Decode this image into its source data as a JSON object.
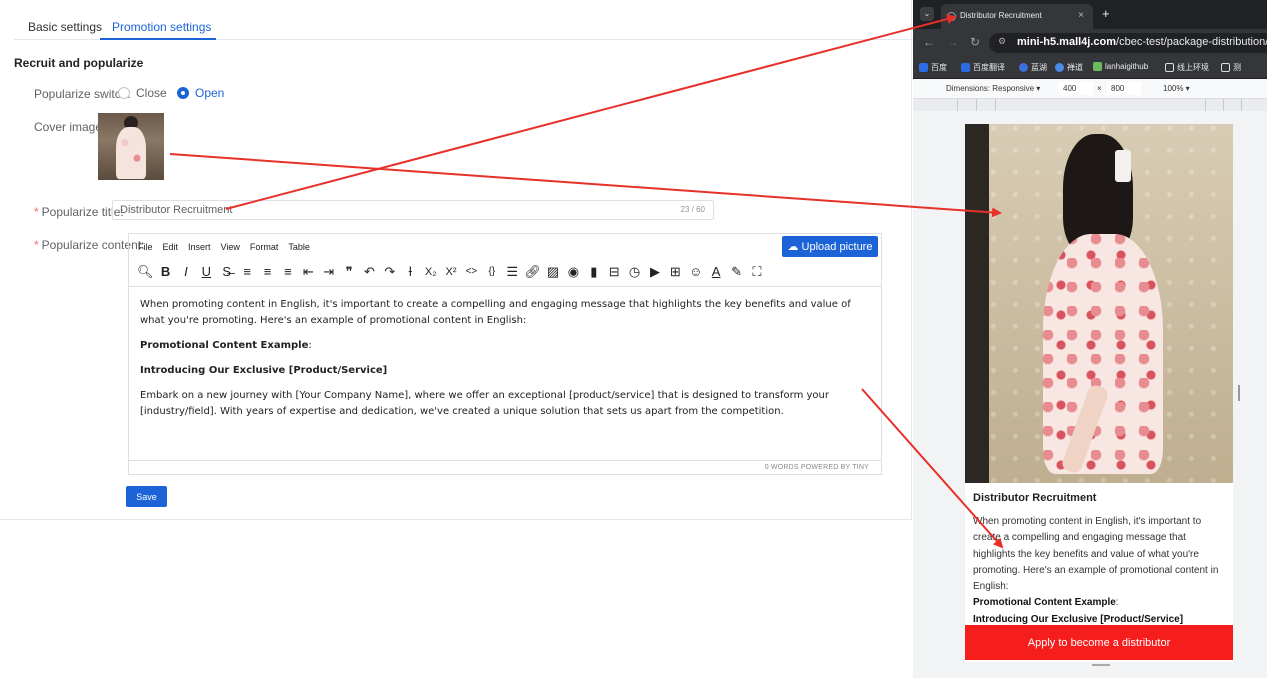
{
  "admin": {
    "tabs": [
      "Basic settings",
      "Promotion settings"
    ],
    "section_title": "Recruit and popularize",
    "switch_label": "Popularize switch:",
    "switch_options": [
      "Close",
      "Open"
    ],
    "cover_label": "Cover image:",
    "title_label": "Popularize title:",
    "title_value": "Distributor Recruitment",
    "title_count": "23 / 60",
    "content_label": "Popularize content:",
    "editor": {
      "menus": [
        "File",
        "Edit",
        "Insert",
        "View",
        "Format",
        "Table"
      ],
      "upload_button": "Upload picture",
      "toolbar_icons": [
        "search-icon",
        "bold-icon",
        "italic-icon",
        "underline-icon",
        "strikethrough-icon",
        "align-left-icon",
        "align-center-icon",
        "align-right-icon",
        "outdent-icon",
        "indent-icon",
        "blockquote-icon",
        "undo-icon",
        "redo-icon",
        "clear-format-icon",
        "subscript-icon",
        "superscript-icon",
        "code-icon",
        "code-block-icon",
        "list-icon",
        "link-icon",
        "image-icon",
        "preview-icon",
        "bookmark-icon",
        "page-break-icon",
        "time-icon",
        "media-icon",
        "table-icon",
        "emoji-icon",
        "text-color-icon",
        "highlight-icon",
        "fullscreen-icon"
      ],
      "paragraph_1": "When promoting content in English, it's important to create a compelling and engaging message that highlights the key benefits and value of what you're promoting. Here's an example of promotional content in English:",
      "paragraph_2": "Promotional Content Example",
      "paragraph_3": "Introducing Our Exclusive [Product/Service]",
      "paragraph_4": "Embark on a new journey with [Your Company Name], where we offer an exceptional [product/service] that is designed to transform your [industry/field]. With years of expertise and dedication, we've created a unique solution that sets us apart from the competition.",
      "status": "0 WORDS  POWERED BY TINY"
    },
    "save_button": "Save"
  },
  "browser": {
    "tab_title": "Distributor Recruitment",
    "url_host": "mini-h5.mall4j.com",
    "url_path": "/cbec-test/package-distribution/pag",
    "bookmarks": [
      "百度",
      "百度翻译",
      "蓝湖",
      "禅道",
      "lanhaigithub",
      "线上环境",
      "测"
    ],
    "dimensions_label": "Dimensions: Responsive ▾",
    "width": "400",
    "height": "800",
    "zoom": "100% ▾",
    "phone": {
      "title": "Distributor Recruitment",
      "body_1": "When promoting content in English, it's important to create a compelling and engaging message that highlights the key benefits and value of what you're promoting. Here's an example of promotional content in English:",
      "body_2": "Promotional Content Example",
      "body_3": "Introducing Our Exclusive [Product/Service]",
      "apply_button": "Apply to become a distributor"
    }
  },
  "colors": {
    "primary": "#1d63d8",
    "apply_red": "#f61d1d",
    "arrow_red": "#e8302a"
  }
}
